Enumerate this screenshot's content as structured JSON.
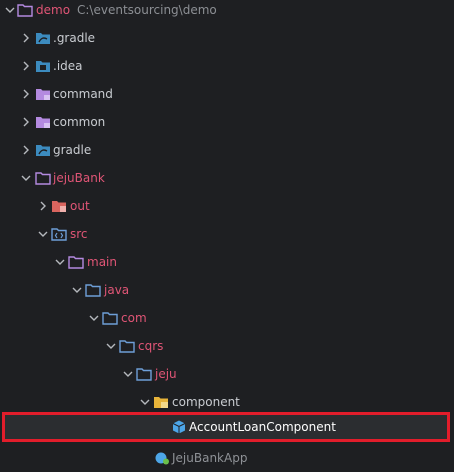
{
  "project": {
    "name": "demo",
    "path": "C:\\eventsourcing\\demo"
  },
  "tree": [
    {
      "label": ".gradle",
      "icon": "gradle-folder-icon"
    },
    {
      "label": ".idea",
      "icon": "idea-folder-icon"
    },
    {
      "label": "command",
      "icon": "module-folder-icon"
    },
    {
      "label": "common",
      "icon": "module-folder-icon"
    },
    {
      "label": "gradle",
      "icon": "gradle-folder-icon"
    },
    {
      "label": "jejuBank",
      "icon": "module-folder-icon"
    },
    {
      "label": "out",
      "icon": "excluded-folder-icon"
    },
    {
      "label": "src",
      "icon": "source-folder-icon"
    },
    {
      "label": "main",
      "icon": "folder-icon"
    },
    {
      "label": "java",
      "icon": "folder-icon"
    },
    {
      "label": "com",
      "icon": "folder-icon"
    },
    {
      "label": "cqrs",
      "icon": "folder-icon"
    },
    {
      "label": "jeju",
      "icon": "folder-icon"
    },
    {
      "label": "component",
      "icon": "package-folder-icon"
    },
    {
      "label": "AccountLoanComponent",
      "icon": "component-class-icon"
    },
    {
      "label": "JejuBankApp",
      "icon": "spring-app-icon"
    }
  ],
  "colors": {
    "background": "#1e1f22",
    "selection_border": "#e21d2b",
    "module_label": "#e05576",
    "folder_purple": "#b48ae0",
    "folder_blue": "#6e9fd8"
  }
}
